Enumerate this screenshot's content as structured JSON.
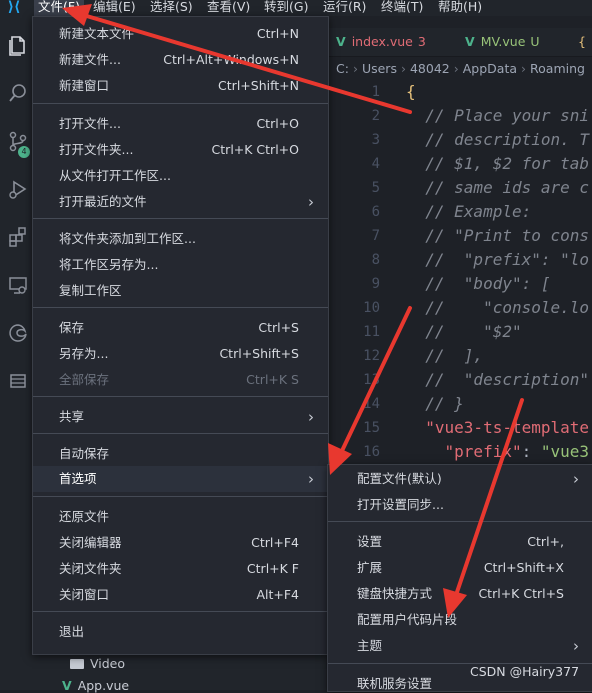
{
  "menubar": {
    "items": [
      "文件(F)",
      "编辑(E)",
      "选择(S)",
      "查看(V)",
      "转到(G)",
      "运行(R)",
      "终端(T)",
      "帮助(H)"
    ]
  },
  "icons": {
    "logo": "vscode-icon",
    "explorer": "files-icon",
    "search": "search-icon",
    "scm": "source-control-icon",
    "run": "run-debug-icon",
    "extensions": "extensions-icon",
    "remote": "remote-explorer-icon",
    "edge": "edge-icon",
    "list": "list-icon"
  },
  "activity": {
    "scm_badge": "4"
  },
  "tabs": [
    {
      "icon": "V",
      "name": "index.vue",
      "status": "3"
    },
    {
      "icon": "V",
      "name": "MV.vue",
      "status": "U"
    },
    {
      "icon": "{",
      "name": "",
      "status": ""
    }
  ],
  "breadcrumb": [
    "C:",
    "Users",
    "48042",
    "AppData",
    "Roaming"
  ],
  "code": {
    "lines": [
      {
        "n": "1",
        "t": "{",
        "k": "brace"
      },
      {
        "n": "2",
        "t": "  // Place your sni",
        "k": "cmt"
      },
      {
        "n": "3",
        "t": "  // description. T",
        "k": "cmt"
      },
      {
        "n": "4",
        "t": "  // $1, $2 for tab",
        "k": "cmt"
      },
      {
        "n": "5",
        "t": "  // same ids are c",
        "k": "cmt"
      },
      {
        "n": "6",
        "t": "  // Example:",
        "k": "cmt"
      },
      {
        "n": "7",
        "t": "  // \"Print to cons",
        "k": "cmt"
      },
      {
        "n": "8",
        "t": "  //  \"prefix\": \"lo",
        "k": "cmt"
      },
      {
        "n": "9",
        "t": "  //  \"body\": [",
        "k": "cmt"
      },
      {
        "n": "10",
        "t": "  //    \"console.lo",
        "k": "cmt"
      },
      {
        "n": "11",
        "t": "  //    \"$2\"",
        "k": "cmt"
      },
      {
        "n": "12",
        "t": "  //  ],",
        "k": "cmt"
      },
      {
        "n": "13",
        "t": "  //  \"description\"",
        "k": "cmt"
      },
      {
        "n": "14",
        "t": "  // }",
        "k": "cmt"
      },
      {
        "n": "15",
        "t": "  \"vue3-ts-template",
        "k": "str"
      },
      {
        "n": "16",
        "t": "    \"prefix\": \"vue3",
        "k": "prefix"
      }
    ]
  },
  "file_menu": {
    "items": [
      {
        "label": "新建文本文件",
        "shortcut": "Ctrl+N"
      },
      {
        "label": "新建文件...",
        "shortcut": "Ctrl+Alt+Windows+N"
      },
      {
        "label": "新建窗口",
        "shortcut": "Ctrl+Shift+N"
      },
      {
        "label": "打开文件...",
        "shortcut": "Ctrl+O"
      },
      {
        "label": "打开文件夹...",
        "shortcut": "Ctrl+K Ctrl+O"
      },
      {
        "label": "从文件打开工作区...",
        "shortcut": ""
      },
      {
        "label": "打开最近的文件",
        "shortcut": "",
        "submenu": true
      },
      {
        "label": "将文件夹添加到工作区...",
        "shortcut": ""
      },
      {
        "label": "将工作区另存为...",
        "shortcut": ""
      },
      {
        "label": "复制工作区",
        "shortcut": ""
      },
      {
        "label": "保存",
        "shortcut": "Ctrl+S"
      },
      {
        "label": "另存为...",
        "shortcut": "Ctrl+Shift+S"
      },
      {
        "label": "全部保存",
        "shortcut": "Ctrl+K S",
        "disabled": true
      },
      {
        "label": "共享",
        "shortcut": "",
        "submenu": true
      },
      {
        "label": "自动保存",
        "shortcut": ""
      },
      {
        "label": "首选项",
        "shortcut": "",
        "submenu": true,
        "selected": true
      },
      {
        "label": "还原文件",
        "shortcut": ""
      },
      {
        "label": "关闭编辑器",
        "shortcut": "Ctrl+F4"
      },
      {
        "label": "关闭文件夹",
        "shortcut": "Ctrl+K F"
      },
      {
        "label": "关闭窗口",
        "shortcut": "Alt+F4"
      },
      {
        "label": "退出",
        "shortcut": ""
      }
    ]
  },
  "pref_menu": {
    "items": [
      {
        "label": "配置文件(默认)",
        "shortcut": "",
        "submenu": true
      },
      {
        "label": "打开设置同步...",
        "shortcut": ""
      },
      {
        "label": "设置",
        "shortcut": "Ctrl+,"
      },
      {
        "label": "扩展",
        "shortcut": "Ctrl+Shift+X"
      },
      {
        "label": "键盘快捷方式",
        "shortcut": "Ctrl+K Ctrl+S"
      },
      {
        "label": "配置用户代码片段",
        "shortcut": ""
      },
      {
        "label": "主题",
        "shortcut": "",
        "submenu": true
      },
      {
        "label": "联机服务设置",
        "shortcut": ""
      }
    ]
  },
  "sidebar": {
    "tree": [
      {
        "label": "Video",
        "icon": "folder-icon"
      },
      {
        "label": "App.vue",
        "icon": "vue-file-icon"
      }
    ]
  },
  "watermark": "CSDN @Hairy377",
  "colors": {
    "annotation": "#e8382f",
    "accent": "#23a9f2"
  }
}
